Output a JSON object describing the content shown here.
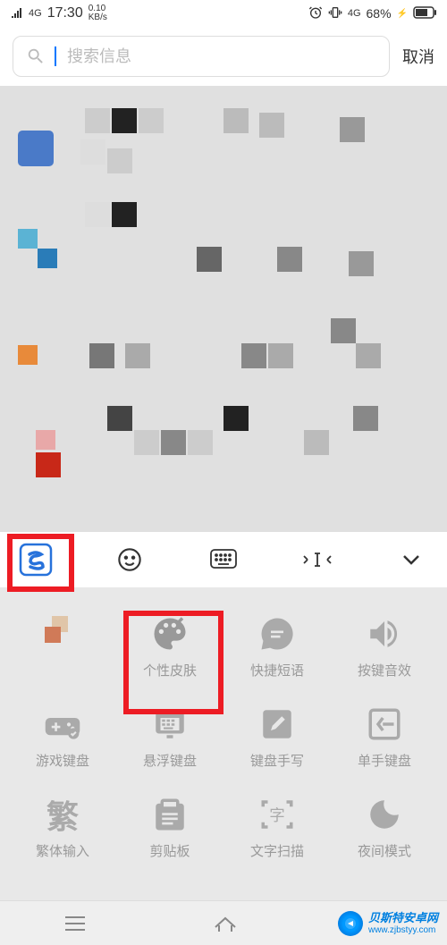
{
  "statusBar": {
    "signal": "G",
    "carrier": "4G",
    "time": "17:30",
    "netSpeed": "0.10",
    "netUnit": "KB/s",
    "alarm": "⏰",
    "vibrate": "📳",
    "data": "4G",
    "battery": "68%"
  },
  "search": {
    "placeholder": "搜索信息",
    "cancel": "取消"
  },
  "keyboardBar": {
    "items": [
      "logo",
      "emoji",
      "keyboard",
      "cursor",
      "collapse"
    ]
  },
  "options": {
    "row1": [
      {
        "name": "input-method",
        "label": ""
      },
      {
        "name": "theme",
        "label": "个性皮肤"
      },
      {
        "name": "phrases",
        "label": "快捷短语"
      },
      {
        "name": "sound",
        "label": "按键音效"
      }
    ],
    "row2": [
      {
        "name": "game-keyboard",
        "label": "游戏键盘"
      },
      {
        "name": "float-keyboard",
        "label": "悬浮键盘"
      },
      {
        "name": "handwriting",
        "label": "键盘手写"
      },
      {
        "name": "onehand",
        "label": "单手键盘"
      }
    ],
    "row3": [
      {
        "name": "traditional",
        "label": "繁体输入"
      },
      {
        "name": "clipboard",
        "label": "剪贴板"
      },
      {
        "name": "text-scan",
        "label": "文字扫描"
      },
      {
        "name": "night-mode",
        "label": "夜间模式"
      }
    ]
  },
  "watermark": {
    "title": "贝斯特安卓网",
    "url": "www.zjbstyy.com"
  }
}
